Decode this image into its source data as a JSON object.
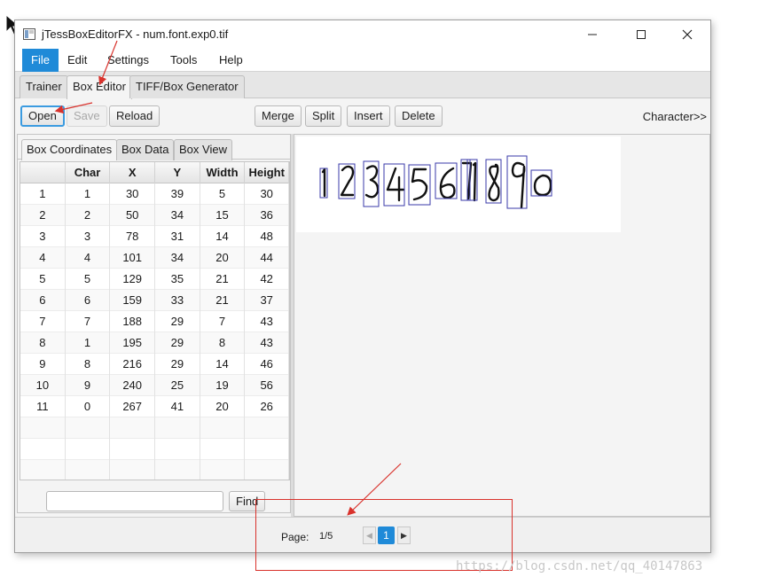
{
  "window": {
    "title": "jTessBoxEditorFX - num.font.exp0.tif",
    "controls": {
      "minimize": "—",
      "maximize": "☐",
      "close": "✕"
    }
  },
  "menubar": {
    "items": [
      "File",
      "Edit",
      "Settings",
      "Tools",
      "Help"
    ],
    "active": "File"
  },
  "main_tabs": {
    "items": [
      "Trainer",
      "Box Editor",
      "TIFF/Box Generator"
    ],
    "selected": "Box Editor"
  },
  "toolbar": {
    "open": "Open",
    "save": "Save",
    "reload": "Reload",
    "merge": "Merge",
    "split": "Split",
    "insert": "Insert",
    "delete": "Delete",
    "character": "Character>>"
  },
  "sub_tabs": {
    "items": [
      "Box Coordinates",
      "Box Data",
      "Box View"
    ],
    "selected": "Box Coordinates"
  },
  "table": {
    "headers": [
      "",
      "Char",
      "X",
      "Y",
      "Width",
      "Height"
    ],
    "rows": [
      [
        "1",
        "1",
        "30",
        "39",
        "5",
        "30"
      ],
      [
        "2",
        "2",
        "50",
        "34",
        "15",
        "36"
      ],
      [
        "3",
        "3",
        "78",
        "31",
        "14",
        "48"
      ],
      [
        "4",
        "4",
        "101",
        "34",
        "20",
        "44"
      ],
      [
        "5",
        "5",
        "129",
        "35",
        "21",
        "42"
      ],
      [
        "6",
        "6",
        "159",
        "33",
        "21",
        "37"
      ],
      [
        "7",
        "7",
        "188",
        "29",
        "7",
        "43"
      ],
      [
        "8",
        "1",
        "195",
        "29",
        "8",
        "43"
      ],
      [
        "9",
        "8",
        "216",
        "29",
        "14",
        "46"
      ],
      [
        "10",
        "9",
        "240",
        "25",
        "19",
        "56"
      ],
      [
        "11",
        "0",
        "267",
        "41",
        "20",
        "26"
      ]
    ]
  },
  "find": {
    "value": "",
    "button": "Find"
  },
  "pagination": {
    "label": "Page:",
    "count": "1/5",
    "current": "1",
    "prev": "◀",
    "next": "▶"
  },
  "watermark": "https://blog.csdn.net/qq_40147863",
  "colors": {
    "accent": "#1f8ad8",
    "annotation": "#d9322c",
    "box_outline": "#3a3aa8"
  },
  "icons": [
    "app-icon",
    "mouse-cursor-icon",
    "minimize-icon",
    "maximize-icon",
    "close-icon"
  ]
}
